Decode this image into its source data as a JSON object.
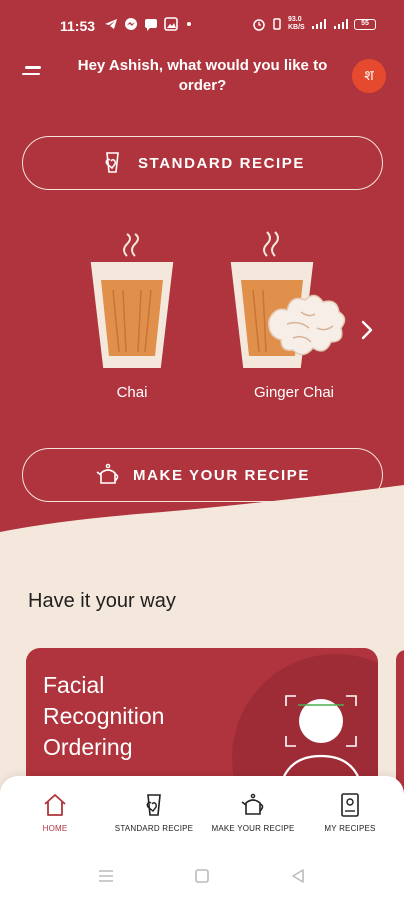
{
  "status_bar": {
    "time": "11:53",
    "network_speed": "93.0 KB/S",
    "battery": "55"
  },
  "header": {
    "greeting": "Hey Ashish, what would you like to order?",
    "avatar_letter": "श"
  },
  "buttons": {
    "standard_recipe": "STANDARD RECIPE",
    "make_your_recipe": "MAKE YOUR RECIPE"
  },
  "recipes": [
    {
      "name": "Chai"
    },
    {
      "name": "Ginger Chai"
    }
  ],
  "section": {
    "title": "Have it your way"
  },
  "feature_card": {
    "title": "Facial Recognition Ordering"
  },
  "bottom_nav": [
    {
      "label": "HOME",
      "active": true
    },
    {
      "label": "STANDARD RECIPE",
      "active": false
    },
    {
      "label": "MAKE YOUR RECIPE",
      "active": false
    },
    {
      "label": "MY RECIPES",
      "active": false
    }
  ],
  "colors": {
    "primary": "#B0343D",
    "cream": "#F4E8DC",
    "tea": "#E0904A",
    "avatar": "#E64A2E"
  }
}
